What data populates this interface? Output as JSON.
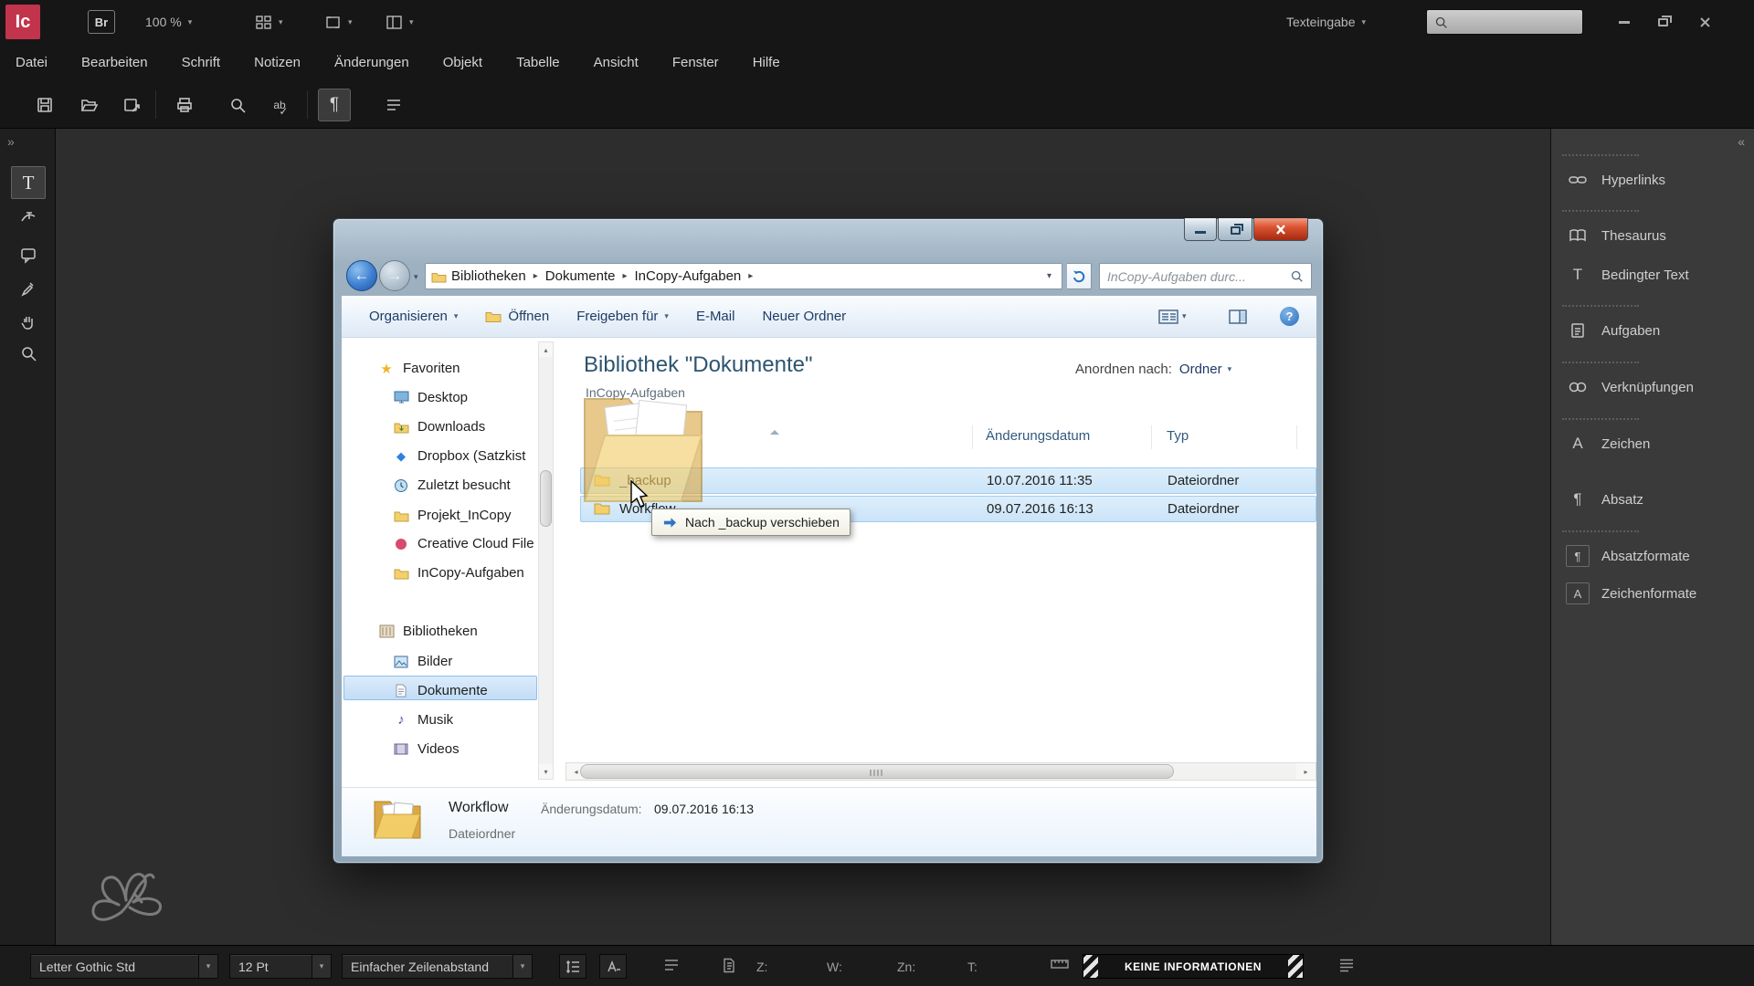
{
  "icons": {
    "dropdown": "▾",
    "crumb_sep": "▸",
    "expand_right": "»",
    "collapse_left": "«",
    "pilcrow": "¶",
    "type": "T",
    "character": "A",
    "spellcheck": "ab",
    "check": "✓",
    "help": "?",
    "star": "★",
    "diamond": "◆",
    "music_note": "♪",
    "back_arrow": "←",
    "forward_arrow": "→",
    "scroll_up": "▴",
    "scroll_down": "▾",
    "scroll_left": "◂",
    "scroll_right": "▸"
  },
  "topbar": {
    "logo": "Ic",
    "bridge": "Br",
    "zoom": "100 %",
    "workspace": "Texteingabe"
  },
  "menubar": {
    "items": [
      "Datei",
      "Bearbeiten",
      "Schrift",
      "Notizen",
      "Änderungen",
      "Objekt",
      "Tabelle",
      "Ansicht",
      "Fenster",
      "Hilfe"
    ]
  },
  "panel": {
    "items": [
      {
        "label": "Hyperlinks"
      },
      {
        "label": "Thesaurus"
      },
      {
        "label": "Bedingter Text"
      },
      {
        "label": "Aufgaben"
      },
      {
        "label": "Verknüpfungen"
      },
      {
        "label": "Zeichen"
      },
      {
        "label": "Absatz"
      },
      {
        "label": "Absatzformate"
      },
      {
        "label": "Zeichenformate"
      }
    ]
  },
  "statusbar": {
    "font": "Letter Gothic Std",
    "size": "12 Pt",
    "leading": "Einfacher Zeilenabstand",
    "field_z": "Z:",
    "field_w": "W:",
    "field_zn": "Zn:",
    "field_t": "T:",
    "info": "KEINE INFORMATIONEN"
  },
  "explorer": {
    "breadcrumb": {
      "items": [
        "Bibliotheken",
        "Dokumente",
        "InCopy-Aufgaben"
      ]
    },
    "search_placeholder": "InCopy-Aufgaben durc...",
    "commandbar": {
      "organize": "Organisieren",
      "open": "Öffnen",
      "share": "Freigeben für",
      "email": "E-Mail",
      "new_folder": "Neuer Ordner"
    },
    "sidebar": {
      "favorites_header": "Favoriten",
      "favorites": [
        "Desktop",
        "Downloads",
        "Dropbox (Satzkist",
        "Zuletzt besucht",
        "Projekt_InCopy",
        "Creative Cloud File",
        "InCopy-Aufgaben"
      ],
      "libraries_header": "Bibliotheken",
      "libraries": [
        "Bilder",
        "Dokumente",
        "Musik",
        "Videos"
      ]
    },
    "content": {
      "title": "Bibliothek \"Dokumente\"",
      "subtitle": "InCopy-Aufgaben",
      "arrange_label": "Anordnen nach:",
      "arrange_value": "Ordner",
      "col_date": "Änderungsdatum",
      "col_type": "Typ",
      "rows": [
        {
          "name": "_backup",
          "date": "10.07.2016 11:35",
          "type": "Dateiordner"
        },
        {
          "name": "Workflow",
          "date": "09.07.2016 16:13",
          "type": "Dateiordner"
        }
      ],
      "drag_tooltip": "Nach _backup verschieben"
    },
    "details": {
      "name": "Workflow",
      "date_label": "Änderungsdatum:",
      "date_value": "09.07.2016 16:13",
      "type": "Dateiordner"
    }
  }
}
